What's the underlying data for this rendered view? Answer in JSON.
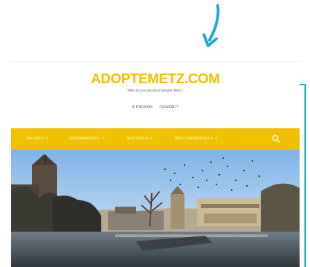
{
  "site": {
    "brand": "ADOPTEMETZ.COM",
    "tagline": "Mille et une raisons d'adopter Metz !",
    "top_links": [
      "A PROPOS",
      "CONTACT"
    ],
    "menu": [
      {
        "label": "BALADES",
        "chevron": "▾"
      },
      {
        "label": "GOURMANDISES",
        "chevron": "▾"
      },
      {
        "label": "QUOTIDIEN",
        "chevron": "▾"
      },
      {
        "label": "METZ EXPERIENCES",
        "chevron": "▾"
      }
    ],
    "icons": {
      "search": "search-icon",
      "annotation": "arrow-down-icon"
    }
  },
  "colors": {
    "accent": "#f1c100",
    "annotation": "#1aa8d8"
  }
}
